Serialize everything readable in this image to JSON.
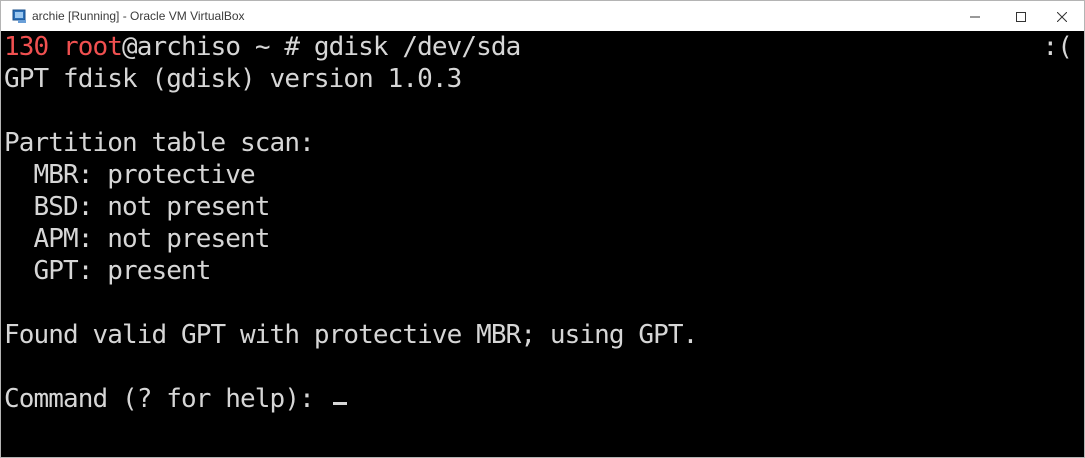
{
  "window": {
    "title": "archie [Running] - Oracle VM VirtualBox",
    "icon": "virtualbox-icon",
    "controls": {
      "minimize": "minimize-icon",
      "maximize": "maximize-icon",
      "close": "close-icon"
    }
  },
  "terminal": {
    "prompt": {
      "exit_code": "130",
      "user": "root",
      "host_path": "@archiso ~ # ",
      "command": "gdisk /dev/sda",
      "status_face": ":("
    },
    "lines": {
      "version": "GPT fdisk (gdisk) version 1.0.3",
      "blank1": "",
      "scan_header": "Partition table scan:",
      "mbr": "  MBR: protective",
      "bsd": "  BSD: not present",
      "apm": "  APM: not present",
      "gpt": "  GPT: present",
      "blank2": "",
      "found": "Found valid GPT with protective MBR; using GPT.",
      "blank3": "",
      "command_prompt": "Command (? for help): "
    },
    "colors": {
      "background": "#000000",
      "text": "#d6d6d6",
      "prompt_red": "#f05050"
    }
  }
}
